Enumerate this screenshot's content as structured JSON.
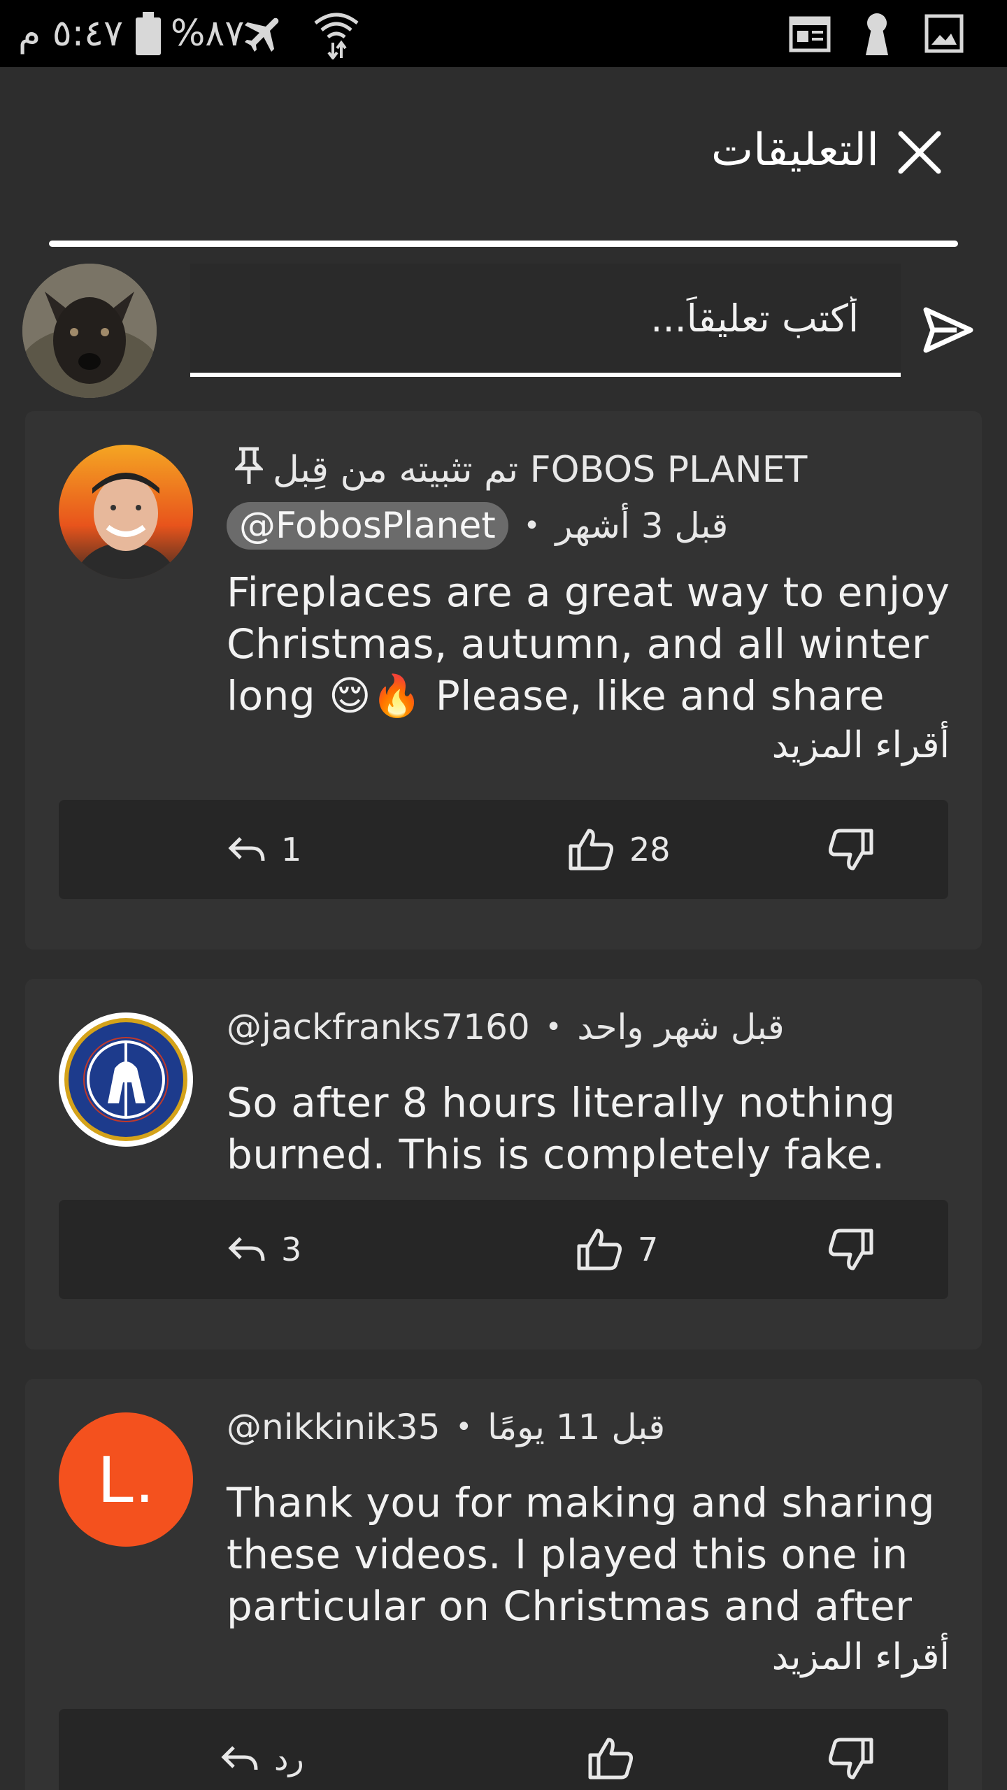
{
  "status_bar": {
    "time": "٥:٤٧ م",
    "battery": "%٨٧",
    "icons": [
      "battery-icon",
      "airplane-mode-icon",
      "wifi-icon",
      "news-icon",
      "keyhole-icon",
      "image-icon"
    ]
  },
  "header": {
    "title": "التعليقات",
    "close_icon": "close-icon"
  },
  "composer": {
    "placeholder": "أكتب تعليقاً...",
    "send_icon": "send-icon"
  },
  "comments": [
    {
      "pinned_label": "تم تثبيته من قِبل FOBOS PLANET",
      "time": "قبل 3 أشهر",
      "handle": "@FobosPlanet",
      "text": "Fireplaces are a great way to enjoy Christmas, autumn, and all winter long 😌🔥 Please, like and share",
      "read_more": "أقراء المزيد",
      "replies": "1",
      "likes": "28"
    },
    {
      "time": "قبل شهر واحد",
      "handle": "@jackfranks7160",
      "text": "So after 8 hours literally nothing burned.  This is completely fake.",
      "replies": "3",
      "likes": "7"
    },
    {
      "avatar_letter": "L.",
      "time": "قبل 11 يومًا",
      "handle": "@nikkinik35",
      "text": "Thank you for making and sharing these videos. I played this one in particular on Christmas and after",
      "read_more": "أقراء المزيد",
      "reply_label": "رد"
    }
  ],
  "colors": {
    "background": "#2d2d2d",
    "card": "#333333",
    "action_bar": "#262626",
    "avatar_orange": "#f4511e",
    "chip": "#6b6b6b"
  }
}
